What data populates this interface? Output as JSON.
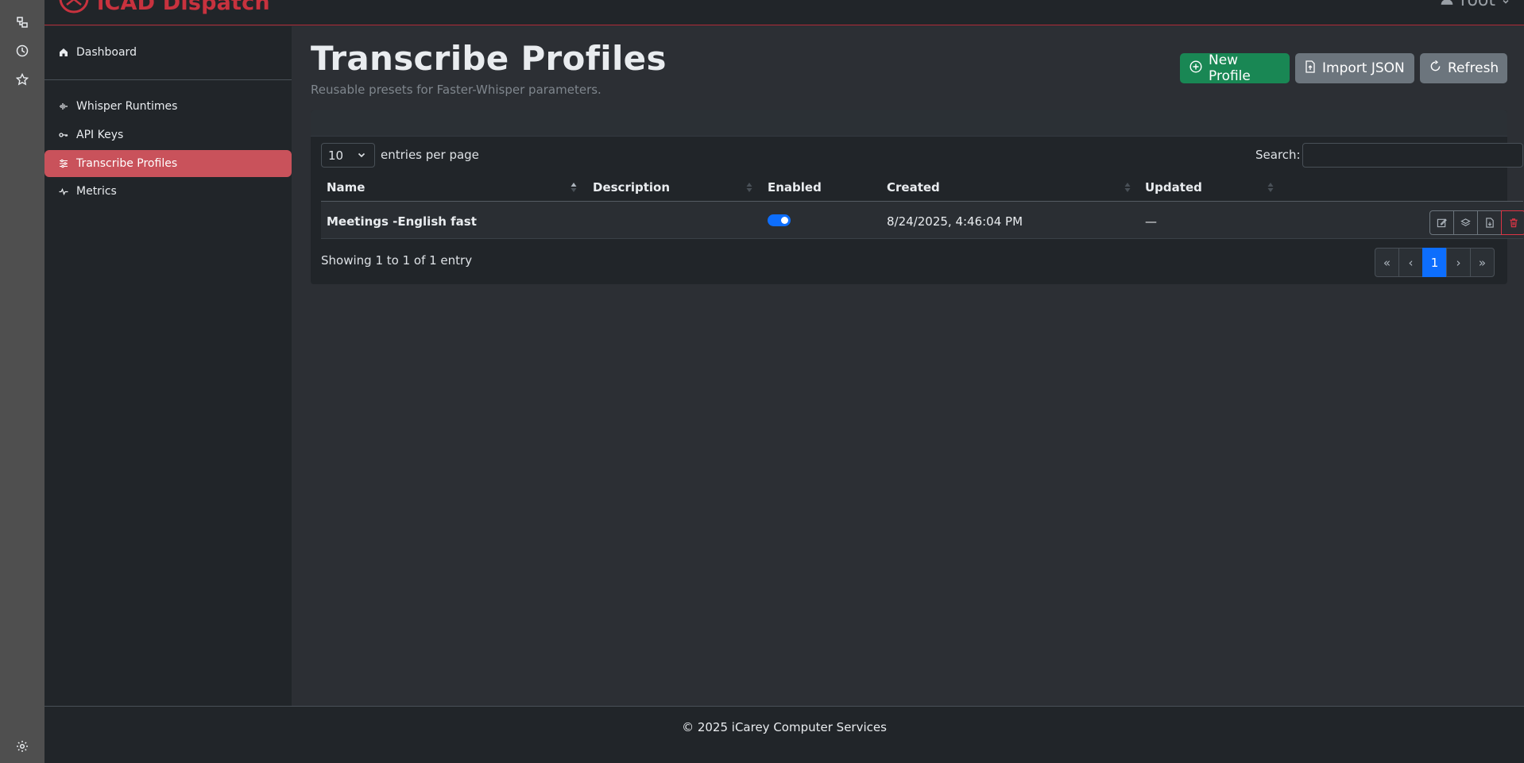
{
  "brand": {
    "name": "iCAD Dispatch",
    "accent": "#c8323e"
  },
  "user": {
    "name": "root"
  },
  "rail": {
    "icons": [
      "diagram-icon",
      "clock-icon",
      "star-icon",
      "gear-icon"
    ]
  },
  "sidebar": {
    "items": [
      {
        "label": "Dashboard",
        "icon": "home-icon",
        "active": false
      },
      {
        "label": "Whisper Runtimes",
        "icon": "waveform-icon",
        "active": false
      },
      {
        "label": "API Keys",
        "icon": "key-icon",
        "active": false
      },
      {
        "label": "Transcribe Profiles",
        "icon": "sliders-icon",
        "active": true
      },
      {
        "label": "Metrics",
        "icon": "pulse-icon",
        "active": false
      }
    ]
  },
  "page": {
    "title": "Transcribe Profiles",
    "subtitle": "Reusable presets for Faster-Whisper parameters."
  },
  "toolbar": {
    "new_label": "New Profile",
    "import_label": "Import JSON",
    "refresh_label": "Refresh"
  },
  "table": {
    "length_value": "10",
    "length_label": "entries per page",
    "search_label": "Search:",
    "search_value": "",
    "columns": [
      "Name",
      "Description",
      "Enabled",
      "Created",
      "Updated"
    ],
    "rows": [
      {
        "name": "Meetings -English fast",
        "description": "",
        "enabled": true,
        "created": "8/24/2025, 4:46:04 PM",
        "updated": "—"
      }
    ],
    "info": "Showing 1 to 1 of 1 entry",
    "pagination": [
      "«",
      "‹",
      "1",
      "›",
      "»"
    ],
    "current_page": "1"
  },
  "footer": {
    "text": "© 2025 iCarey Computer Services"
  }
}
